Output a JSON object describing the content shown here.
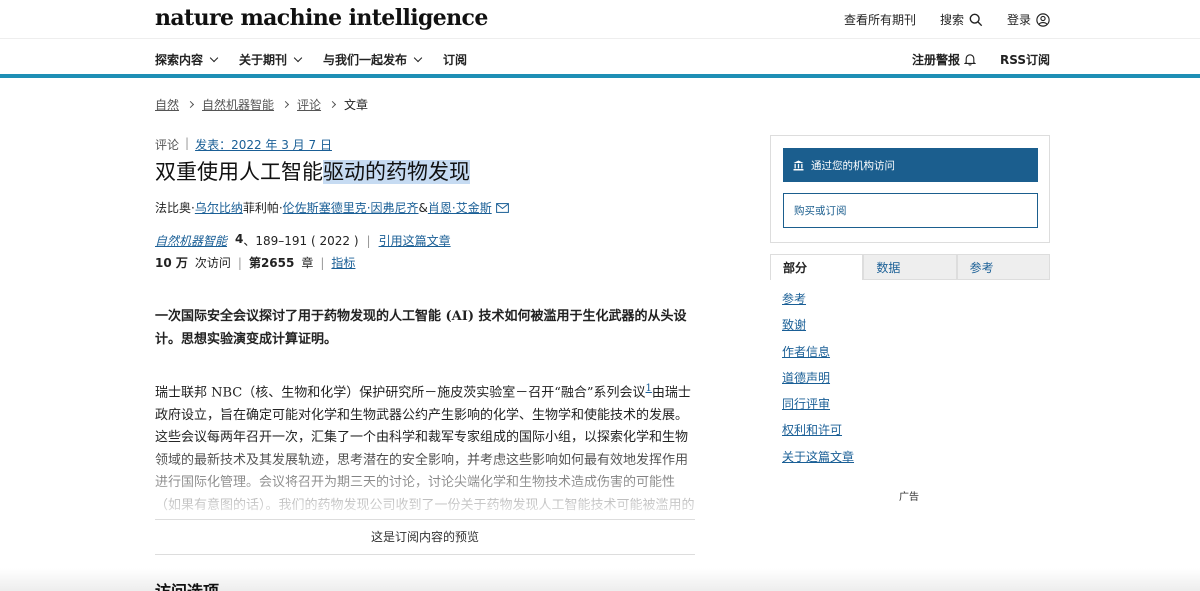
{
  "header": {
    "logo": "nature machine intelligence",
    "all_journals": "查看所有期刊",
    "search": "搜索",
    "login": "登录"
  },
  "nav": {
    "items": [
      "探索内容",
      "关于期刊",
      "与我们一起发布",
      "订阅"
    ],
    "alert": "注册警报",
    "rss": "RSS订阅"
  },
  "breadcrumb": [
    "自然",
    "自然机器智能",
    "评论",
    "文章"
  ],
  "article": {
    "type": "评论",
    "published": "发表：2022 年 3 月 7 日",
    "title_plain": "双重使用人工智能",
    "title_highlight": "驱动的药物发现",
    "authors": {
      "a1_prefix": "法比奥·",
      "a1_link": "乌尔比纳",
      "a2_prefix": "菲利帕·",
      "a2_link": "伦佐斯",
      "a3_link": "塞德里克·因弗尼齐",
      "amp": "&",
      "a4_link": "肖恩·艾金斯"
    },
    "journal": "自然机器智能",
    "volume": "4",
    "pages": "、189–191 ( 2022 )",
    "cite": "引用这篇文章",
    "accesses_num": "10 万",
    "accesses_label": "次访问",
    "citations": "第2655",
    "citations_label": "章",
    "metrics": "指标",
    "abstract": "一次国际安全会议探讨了用于药物发现的人工智能 (AI) 技术如何被滥用于生化武器的从头设计。思想实验演变成计算证明。",
    "body_before_sup": "瑞士联邦 NBC（核、生物和化学）保护研究所－施皮茨实验室－召开“融合”系列会议",
    "sup": "1",
    "body_after_sup": "由瑞士政府设立，旨在确定可能对化学和生物武器公约产生影响的化学、生物学和使能技术的发展。这些会议每两年召开一次，汇集了一个由科学和裁军专家组成的国际小组，以探索化学和生物领域的最新技术及其发展轨迹，思考潜在的安全影响，并考虑这些影响如何最有效地发挥作用进行国际化管理。会议将召开为期三天的讨论，讨论尖端化学和生物技术造成伤害的可能性（如果有意图的话）。我们的药物发现公司收到了一份关于药物发现人工智能技术可能被滥用的简",
    "preview_notice": "这是订阅内容的预览",
    "access_options": "访问选项"
  },
  "sidebar": {
    "institution": "通过您的机构访问",
    "buy": "购买或订阅",
    "tabs": [
      "部分",
      "数据",
      "参考"
    ],
    "sections": [
      "参考",
      "致谢",
      "作者信息",
      "道德声明",
      "同行评审",
      "权利和许可",
      "关于这篇文章"
    ],
    "ad": "广告"
  },
  "colors": {
    "accent": "#1e8fb5",
    "link": "#1a5f96",
    "button": "#1b5e8e",
    "highlight": "#c6dbf2"
  }
}
